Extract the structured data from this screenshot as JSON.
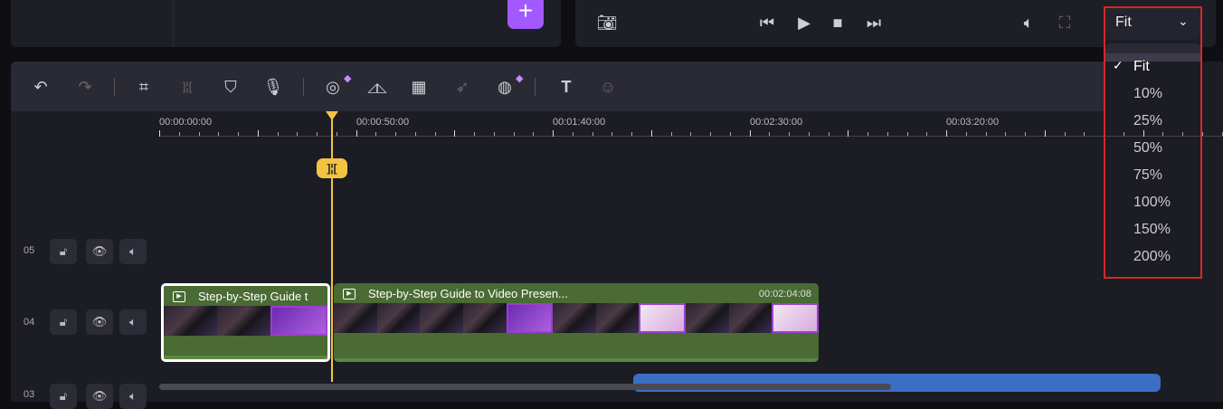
{
  "preview": {
    "zoom_value": "Fit",
    "zoom_options": [
      "Fit",
      "10%",
      "25%",
      "50%",
      "75%",
      "100%",
      "150%",
      "200%"
    ],
    "selected_option": "Fit"
  },
  "ruler": {
    "labels": [
      "00:00:00:00",
      "00:00:50:00",
      "00:01:40:00",
      "00:02:30:00",
      "00:03:20:00"
    ]
  },
  "tracks": [
    {
      "number": "05"
    },
    {
      "number": "04"
    },
    {
      "number": "03"
    }
  ],
  "clips": [
    {
      "title": "Step-by-Step Guide t",
      "selected": true
    },
    {
      "title": "Step-by-Step Guide to Video Presen...",
      "duration": "00:02:04:08"
    }
  ],
  "colors": {
    "accent": "#a259ff",
    "playhead": "#f5c342",
    "clip": "#4a6b34",
    "highlight": "#d12a2a",
    "audio_clip": "#3a6fc4"
  }
}
